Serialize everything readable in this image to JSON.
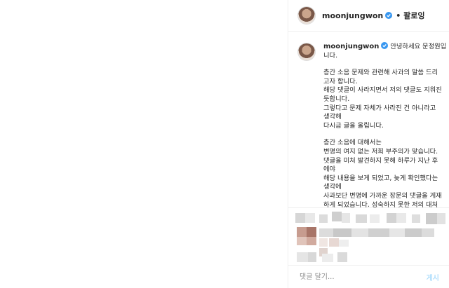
{
  "header": {
    "username": "moonjungwon",
    "follow_label": "• 팔로잉"
  },
  "caption": {
    "username": "moonjungwon",
    "lines_intro": [
      "안녕하세요 문정원입",
      "니다."
    ],
    "para1": [
      "층간 소음 문제와 관련해 사과의 말씀 드리",
      "고자 합니다.",
      "해당 댓글이 사라지면서 저의 댓글도 지워진",
      "듯합니다.",
      "그렇다고 문제 자체가 사라진 건 아니라고",
      "생각해",
      "다시금 글을 올립니다."
    ],
    "para2": [
      "층간 소음에 대해서는",
      "변명의 여지 없는 저희 부주의가 맞습니다.",
      "댓글을 미처 발견하지 못해 하루가 지난 후",
      "에야",
      "해당 내용을 보게 되었고, 늦게 확인했다는",
      "생각에",
      "사과보단 변명에 가까운 장문의 댓글을 게재",
      "하게 되었습니다. 성숙하지 못한 저의 대처"
    ]
  },
  "comment_box": {
    "placeholder": "댓글 달기...",
    "post_label": "게시"
  }
}
